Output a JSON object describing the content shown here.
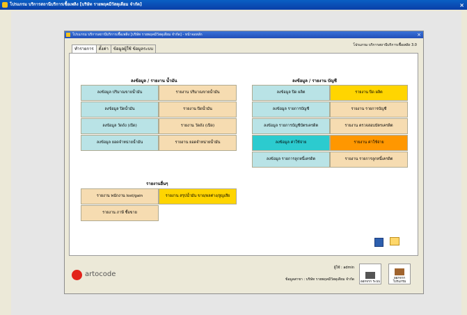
{
  "outer_window": {
    "title": "โปรแกรม บริการสถานีบริการเชื้อเพลิง [บริษัท รายพฤคมีวัสดุเดียม จำกัด]"
  },
  "inner_window": {
    "title": "โปรแกรม บริการสถานีบริการเชื้อเพลิง [บริษัท รายพฤคมีวัสดุเดียม จำกัด] - หน้าจอหลัก"
  },
  "tabs": [
    "ทำรายการ",
    "ตั้งค่า",
    "ข้อมูลผู้ใช้ ข้อมูลระบบ"
  ],
  "version": "โปรแกรม บริการสถานีบริการเชื้อเพลิง 3.0",
  "left_section": {
    "heading": "ลงข้อมูล / รายงาน น้ำมัน",
    "rows": [
      [
        "ลงข้อมูล ปริมาณขายน้ำมัน",
        "รายงาน ปริมาณขายน้ำมัน"
      ],
      [
        "ลงข้อมูล ปิดน้ำมัน",
        "รายงาน ปิดน้ำมัน"
      ],
      [
        "ลงข้อมูล วัดถัง (เปิด)",
        "รายงาน วัดถัง (เปิด)"
      ],
      [
        "ลงข้อมูล ยอดจำหน่ายน้ำมัน",
        "รายงาน ยอดจำหน่ายน้ำมัน"
      ]
    ]
  },
  "right_section": {
    "heading": "ลงข้อมูล / รายงาน บัญชี",
    "rows": [
      [
        "ลงข้อมูล ปิด ผลิต",
        "รายงาน ปิด ผลิต"
      ],
      [
        "ลงข้อมูล รายการบัญชี",
        "รายงาน รายการบัญชี"
      ],
      [
        "ลงข้อมูล รายการบัญชีบัตรเครดิต",
        "รายงาน ตรวจสอบบัตรเครดิต"
      ],
      [
        "ลงข้อมูล ค่าใช้จ่าย",
        "รายงาน ค่าใช้จ่าย"
      ],
      [
        "ลงข้อมูล รายการลูกหนี้เครดิต",
        "รายงาน รายการลูกหนี้เครดิต"
      ]
    ]
  },
  "other_section": {
    "heading": "รายงานอื่นๆ",
    "buttons": [
      "รายงาน พนักงาน lost/gain",
      "รายงาน สรุปน้ำมัน ขาย/ผลต่าง/สูญเสีย",
      "รายงาน ภาษี ซื้อขาย"
    ]
  },
  "brand": {
    "logo_text": "artocode"
  },
  "footer": {
    "user": "ผู้ใช้ : admin",
    "company": "ข้อมูลสาขา : บริษัท รายพฤคมีวัสดุเดียม จำกัด",
    "logout_label": "ออกจาก ระบบ",
    "exit_label": "ออกจาก โปรแกรม"
  },
  "colors": {
    "aqua": "#b9e3e6",
    "tan": "#f6dcb1",
    "yellow": "#ffd500",
    "teal": "#2ccbcf",
    "orange": "#ff9700"
  }
}
